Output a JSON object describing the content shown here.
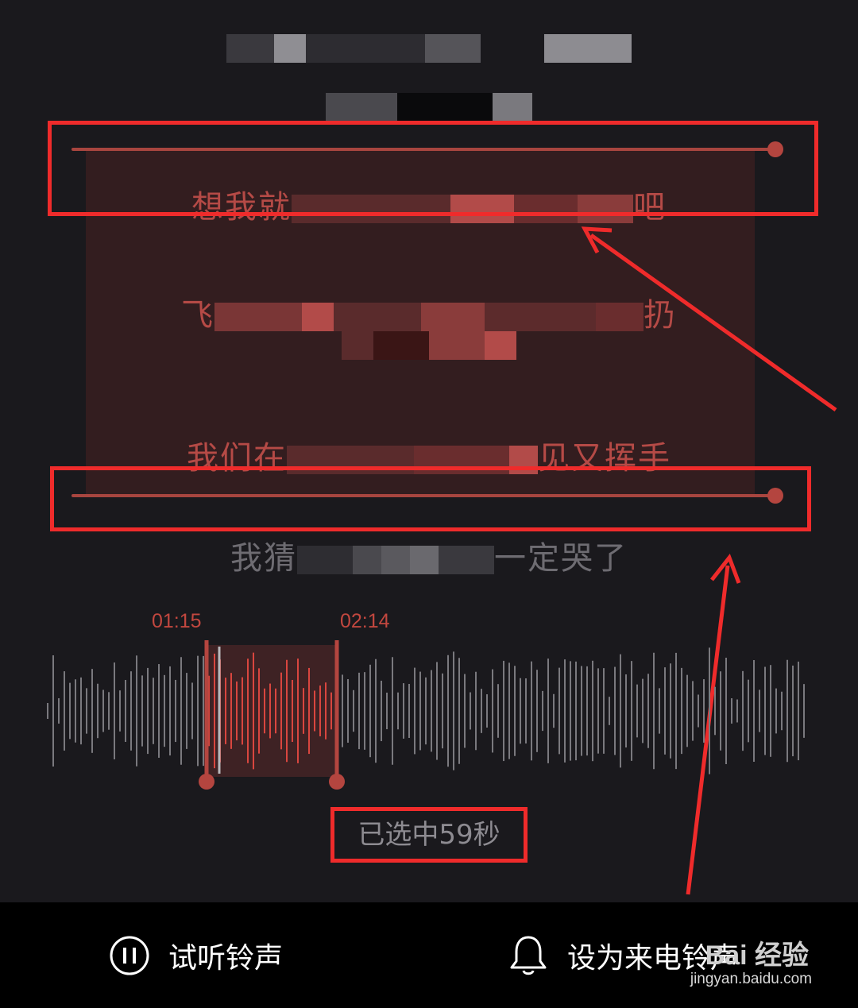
{
  "lyrics": {
    "line_1": "",
    "line_2": "",
    "line_3_start": "想我就",
    "line_3_end": "吧",
    "line_4_start": "飞",
    "line_4_end": "扔",
    "line_5": "",
    "line_6_start": "我们在",
    "line_6_end": "见又挥手",
    "line_7_start": "我猜",
    "line_7_end": "一定哭了"
  },
  "waveform": {
    "start_time": "01:15",
    "end_time": "02:14",
    "selected_label": "已选中59秒"
  },
  "bottom_bar": {
    "preview_label": "试听铃声",
    "set_ringtone_label": "设为来电铃声"
  },
  "watermark": {
    "brand": "Bai 经验",
    "url": "jingyan.baidu.com"
  },
  "colors": {
    "accent": "#b54a46",
    "annotation": "#ef2b2b",
    "background": "#1a191d",
    "bar": "#000000"
  }
}
